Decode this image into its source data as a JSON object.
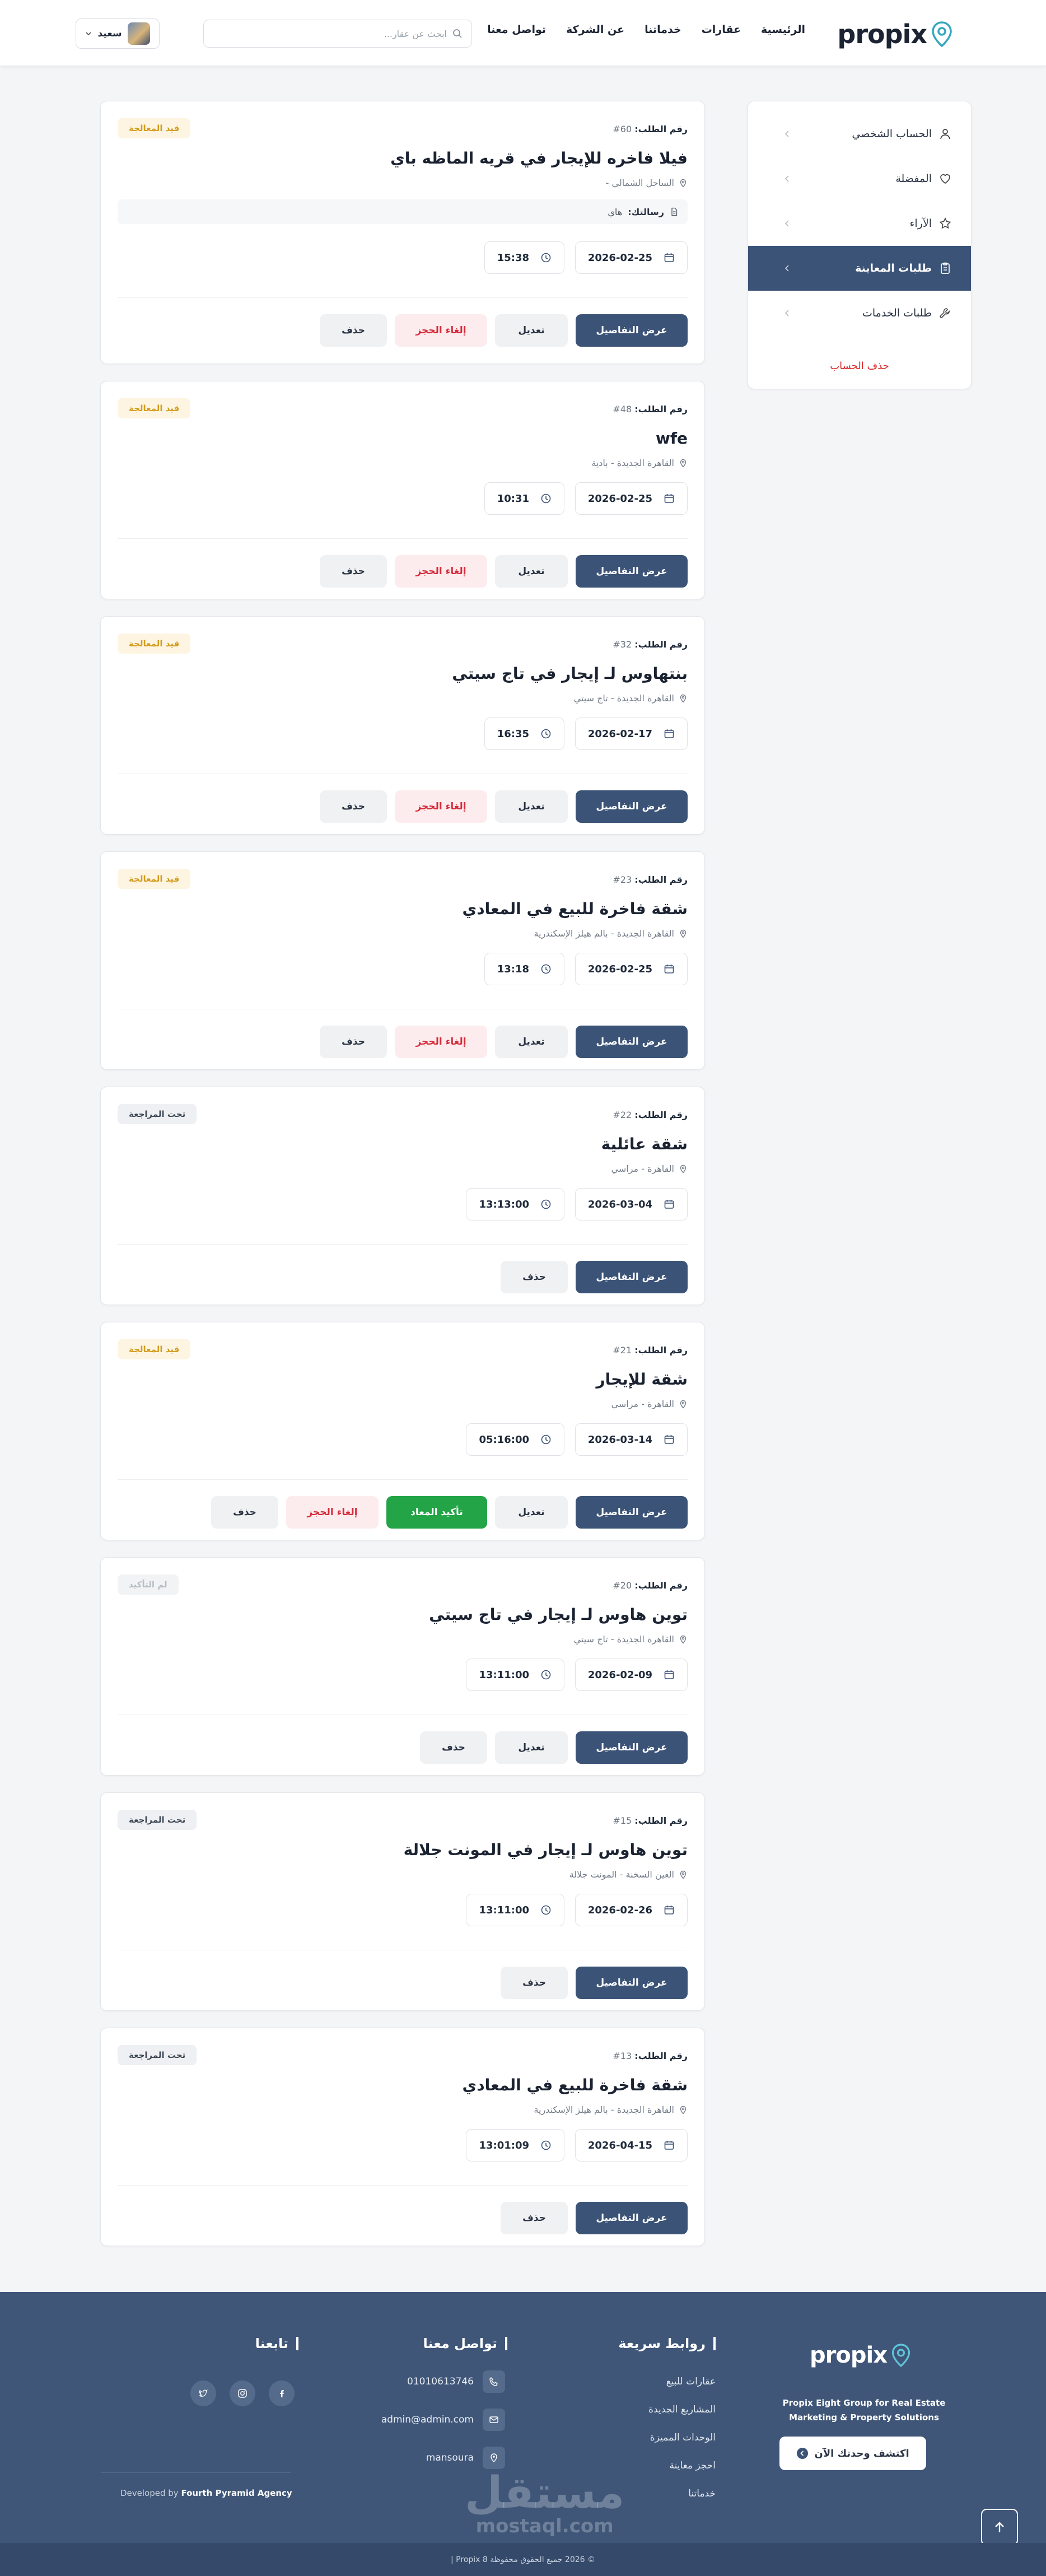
{
  "header": {
    "logo": "propix",
    "nav": [
      "الرئيسية",
      "عقارات",
      "خدماتنا",
      "عن الشركة",
      "تواصل معنا"
    ],
    "search_placeholder": "ابحث عن عقار...",
    "user_name": "سعيد"
  },
  "sidebar": {
    "items": [
      {
        "label": "الحساب الشخصي",
        "icon": "user-icon"
      },
      {
        "label": "المفضلة",
        "icon": "heart-icon"
      },
      {
        "label": "الآراء",
        "icon": "star-icon"
      },
      {
        "label": "طلبات المعاينة",
        "icon": "clipboard-icon"
      },
      {
        "label": "طلبات الخدمات",
        "icon": "wrench-icon"
      }
    ],
    "delete_account": "حذف الحساب"
  },
  "order_label": "رقم الطلب:",
  "cards": [
    {
      "id": "60#",
      "status": "قيد المعالجة",
      "title": "فيلا فاخره للإيجار في قريه الماظه باي",
      "location": "الساحل الشمالي -",
      "message_label": "رسالتك:",
      "message": "هاي",
      "date": "2026-02-25",
      "time": "15:38",
      "buttons": [
        "عرض التفاصيل",
        "تعديل",
        "إلغاء الحجز",
        "حذف"
      ]
    },
    {
      "id": "48#",
      "status": "قيد المعالجة",
      "title": "wfe",
      "location": "القاهرة الجديدة - بادية",
      "date": "2026-02-25",
      "time": "10:31",
      "buttons": [
        "عرض التفاصيل",
        "تعديل",
        "إلغاء الحجز",
        "حذف"
      ]
    },
    {
      "id": "32#",
      "status": "قيد المعالجة",
      "title": "بنتهاوس لـ إيجار في تاج سيتي",
      "location": "القاهرة الجديدة - تاج سيتي",
      "date": "2026-02-17",
      "time": "16:35",
      "buttons": [
        "عرض التفاصيل",
        "تعديل",
        "إلغاء الحجز",
        "حذف"
      ]
    },
    {
      "id": "23#",
      "status": "قيد المعالجة",
      "title": "شقة فاخرة للبيع في المعادي",
      "location": "القاهرة الجديدة - بالم هيلز الإسكندرية",
      "date": "2026-02-25",
      "time": "13:18",
      "buttons": [
        "عرض التفاصيل",
        "تعديل",
        "إلغاء الحجز",
        "حذف"
      ]
    },
    {
      "id": "22#",
      "status": "تحت المراجعة",
      "title": "شقة عائلية",
      "location": "القاهرة - مراسي",
      "date": "2026-03-04",
      "time": "13:13:00",
      "buttons": [
        "عرض التفاصيل",
        "حذف"
      ]
    },
    {
      "id": "21#",
      "status": "قيد المعالجة",
      "title": "شقة للإيجار",
      "location": "القاهرة - مراسي",
      "date": "2026-03-14",
      "time": "05:16:00",
      "buttons": [
        "عرض التفاصيل",
        "تعديل",
        "تأكيد المعاد",
        "إلغاء الحجز",
        "حذف"
      ]
    },
    {
      "id": "20#",
      "status": "لم التأكيد",
      "title": "توين هاوس لـ إيجار في تاج سيتي",
      "location": "القاهرة الجديدة - تاج سيتي",
      "date": "2026-02-09",
      "time": "13:11:00",
      "buttons": [
        "عرض التفاصيل",
        "تعديل",
        "حذف"
      ]
    },
    {
      "id": "15#",
      "status": "تحت المراجعة",
      "title": "توين هاوس لـ إيجار في المونت جلالة",
      "location": "العين السخنة - المونت جلالة",
      "date": "2026-02-26",
      "time": "13:11:00",
      "buttons": [
        "عرض التفاصيل",
        "حذف"
      ]
    },
    {
      "id": "13#",
      "status": "تحت المراجعة",
      "title": "شقة فاخرة للبيع في المعادي",
      "location": "القاهرة الجديدة - بالم هيلز الإسكندرية",
      "date": "2026-04-15",
      "time": "13:01:09",
      "buttons": [
        "عرض التفاصيل",
        "حذف"
      ]
    }
  ],
  "footer": {
    "logo": "propix",
    "description": "Propix Eight Group for Real Estate Marketing & Property Solutions",
    "cta": "اكتشف وحدتك الآن",
    "quick_links_title": "روابط سريعة",
    "quick_links": [
      "عقارات للبيع",
      "المشاريع الجديدة",
      "الوحدات المميزة",
      "احجز معاينة",
      "خدماتنا"
    ],
    "contact_title": "تواصل معنا",
    "phone": "01010613746",
    "email": "admin@admin.com",
    "address": "mansoura",
    "follow_title": "تابعنا",
    "developed_by_prefix": "Developed by",
    "developed_by": "Fourth Pyramid Agency",
    "copyright": "© 2026 جميع الحقوق محفوظة Propix 8 |",
    "watermark_ar": "مستقل",
    "watermark_en": "mostaql.com"
  }
}
